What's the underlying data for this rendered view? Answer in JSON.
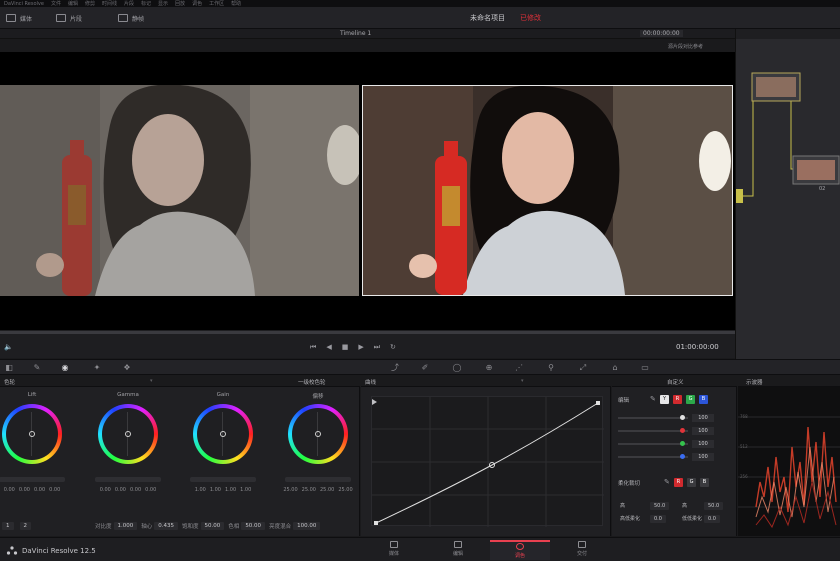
{
  "menu": [
    "DaVinci Resolve",
    "文件",
    "编辑",
    "修剪",
    "时间线",
    "片段",
    "标记",
    "显示",
    "回放",
    "调色",
    "工作区",
    "帮助"
  ],
  "toolbar": {
    "left_buttons": [
      "媒体",
      "片段",
      "静帧"
    ],
    "project_title": "未命名项目",
    "project_status": "已修改"
  },
  "viewer": {
    "timeline_name": "Timeline 1",
    "timecode": "00:00:00:00",
    "option_label": "源片段对比参考",
    "end_timecode": "01:00:00:00"
  },
  "nodes": {
    "node2_label": "02"
  },
  "wheels": {
    "header_left": "色轮",
    "header_mode": "一级校色轮",
    "columns": [
      {
        "label": "Lift",
        "values": [
          "0.00",
          "0.00",
          "0.00",
          "0.00"
        ]
      },
      {
        "label": "Gamma",
        "values": [
          "0.00",
          "0.00",
          "0.00",
          "0.00"
        ]
      },
      {
        "label": "Gain",
        "values": [
          "1.00",
          "1.00",
          "1.00",
          "1.00"
        ]
      },
      {
        "label": "偏移",
        "values": [
          "25.00",
          "25.00",
          "25.00",
          "25.00"
        ]
      }
    ],
    "footer": {
      "page_numbers": [
        "1",
        "2"
      ],
      "fields": [
        {
          "label": "对比度",
          "value": "1.000"
        },
        {
          "label": "轴心",
          "value": "0.435"
        },
        {
          "label": "饱和度",
          "value": "50.00"
        },
        {
          "label": "色相",
          "value": "50.00"
        },
        {
          "label": "亮度混合",
          "value": "100.00"
        }
      ]
    }
  },
  "curves": {
    "header_label": "曲线",
    "curve_mode": "自定义"
  },
  "edit_panel": {
    "header_label": "编辑",
    "channel_buttons": [
      "Y",
      "R",
      "G",
      "B"
    ],
    "rows": [
      {
        "value": "100",
        "color": "#e0e0e0"
      },
      {
        "value": "100",
        "color": "#e0343a"
      },
      {
        "value": "100",
        "color": "#35c24d"
      },
      {
        "value": "100",
        "color": "#3a6cf0"
      }
    ],
    "soft_label": "柔化裁切",
    "soft_buttons": [
      "R",
      "G",
      "B"
    ],
    "soft_fields": [
      {
        "label": "高",
        "value": "50.0"
      },
      {
        "label": "高",
        "value": "50.0"
      },
      {
        "label": "高低柔化",
        "value": "0.0"
      },
      {
        "label": "低低柔化",
        "value": "0.0"
      }
    ]
  },
  "scope": {
    "header_label": "示波器"
  },
  "bottom": {
    "app_name": "DaVinci Resolve 12.5",
    "pages": [
      "媒体",
      "编辑",
      "调色",
      "交付"
    ],
    "active_page": "调色"
  },
  "colors": {
    "accent": "#e94050",
    "panel": "#202023",
    "viewer_bg": "#000000"
  }
}
